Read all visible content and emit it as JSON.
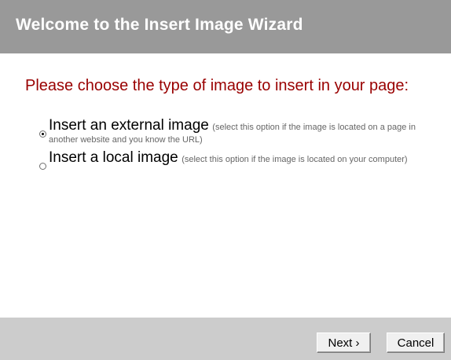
{
  "header": {
    "title": "Welcome to the Insert Image Wizard"
  },
  "prompt": "Please choose the type of image to insert in your page:",
  "options": [
    {
      "title": "Insert an external image",
      "hint": "(select this option if the image is located on a page in another website and you know the URL)",
      "checked": true
    },
    {
      "title": "Insert a local image",
      "hint": "(select this option if the image is located on your computer)",
      "checked": false
    }
  ],
  "footer": {
    "next_label": "Next ›",
    "cancel_label": "Cancel"
  },
  "colors": {
    "header_bg": "#999999",
    "prompt_text": "#990000",
    "footer_bg": "#cccccc"
  }
}
